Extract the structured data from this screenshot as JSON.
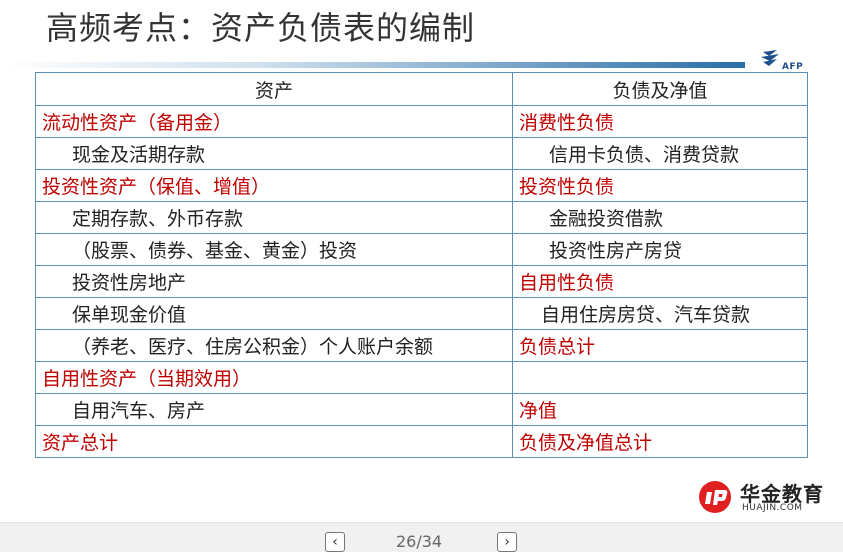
{
  "title": "高频考点：资产负债表的编制",
  "logo_top": {
    "text": "AFP",
    "color": "#1e4e8c"
  },
  "table": {
    "headers": [
      "资产",
      "负债及净值"
    ],
    "rows": [
      {
        "left": "流动性资产（备用金）",
        "left_style": "red",
        "right": "消费性负债",
        "right_style": "red"
      },
      {
        "left": "现金及活期存款",
        "left_style": "indent",
        "right": "信用卡负债、消费贷款",
        "right_style": "indent"
      },
      {
        "left": "投资性资产（保值、增值）",
        "left_style": "red",
        "right": "投资性负债",
        "right_style": "red"
      },
      {
        "left": "定期存款、外币存款",
        "left_style": "indent",
        "right": "金融投资借款",
        "right_style": "indent"
      },
      {
        "left": "（股票、债券、基金、黄金）投资",
        "left_style": "indent",
        "right": "投资性房产房贷",
        "right_style": "indent"
      },
      {
        "left": "投资性房地产",
        "left_style": "indent",
        "right": "自用性负债",
        "right_style": "red"
      },
      {
        "left": "保单现金价值",
        "left_style": "indent",
        "right": "自用住房房贷、汽车贷款",
        "right_style": "indent2"
      },
      {
        "left": "（养老、医疗、住房公积金）个人账户余额",
        "left_style": "indent",
        "right": "负债总计",
        "right_style": "red"
      },
      {
        "left": "自用性资产（当期效用）",
        "left_style": "red",
        "right": "",
        "right_style": "plain"
      },
      {
        "left": "自用汽车、房产",
        "left_style": "indent",
        "right": "净值",
        "right_style": "red"
      },
      {
        "left": "资产总计",
        "left_style": "red",
        "right": "负债及净值总计",
        "right_style": "red"
      }
    ]
  },
  "brand": {
    "name": "华金教育",
    "url": "HUAJIN.COM",
    "color": "#e02020"
  },
  "pager": {
    "text": "26/34",
    "prev_icon": "chevron-left-icon",
    "next_icon": "chevron-right-icon"
  },
  "colors": {
    "accent_red": "#c00000",
    "border": "#5b8fb9"
  }
}
